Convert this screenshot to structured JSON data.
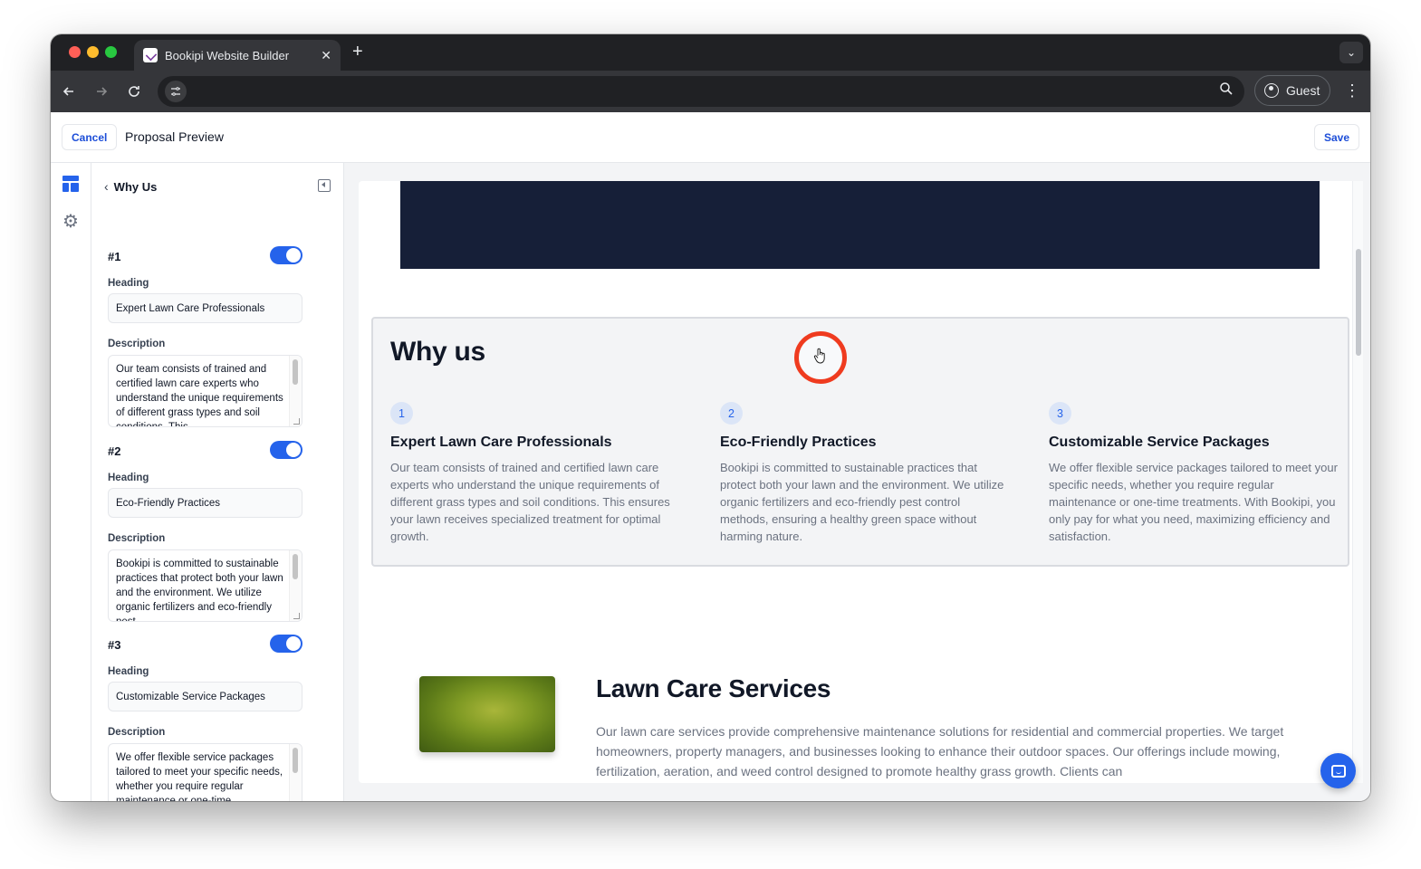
{
  "browser": {
    "tab_title": "Bookipi Website Builder",
    "tab_close": "✕",
    "new_tab": "+",
    "menu_chevron": "⌄",
    "url": "",
    "profile": "Guest",
    "kebab": "⋮",
    "icons": [
      "back-icon",
      "forward-icon",
      "reload-icon",
      "site-info-icon",
      "zoom-icon",
      "profile-icon"
    ]
  },
  "header": {
    "cancel_label": "Cancel",
    "title": "Proposal Preview",
    "save_label": "Save",
    "accent": "#1d4ed8"
  },
  "panel": {
    "back_chevron": "‹",
    "title": "Why Us",
    "heading_label": "Heading",
    "description_label": "Description",
    "items": [
      {
        "num": "#1",
        "enabled": true,
        "heading": "Expert Lawn Care Professionals",
        "description": "Our team consists of trained and certified lawn care experts who understand the unique requirements of different grass types and soil conditions. This"
      },
      {
        "num": "#2",
        "enabled": true,
        "heading": "Eco-Friendly Practices",
        "description": "Bookipi is committed to sustainable practices that protect both your lawn and the environment. We utilize organic fertilizers and eco-friendly pest"
      },
      {
        "num": "#3",
        "enabled": true,
        "heading": "Customizable Service Packages",
        "description": "We offer flexible service packages tailored to meet your specific needs, whether you require regular maintenance or one-time treatments. With Bookipi, you only"
      }
    ]
  },
  "preview": {
    "why_title": "Why us",
    "columns": [
      {
        "num": "1",
        "heading": "Expert Lawn Care Professionals",
        "description": "Our team consists of trained and certified lawn care experts who understand the unique requirements of different grass types and soil conditions. This ensures your lawn receives specialized treatment for optimal growth."
      },
      {
        "num": "2",
        "heading": "Eco-Friendly Practices",
        "description": "Bookipi is committed to sustainable practices that protect both your lawn and the environment. We utilize organic fertilizers and eco-friendly pest control methods, ensuring a healthy green space without harming nature."
      },
      {
        "num": "3",
        "heading": "Customizable Service Packages",
        "description": "We offer flexible service packages tailored to meet your specific needs, whether you require regular maintenance or one-time treatments. With Bookipi, you only pay for what you need, maximizing efficiency and satisfaction."
      }
    ],
    "services_title": "Lawn Care Services",
    "services_description": "Our lawn care services provide comprehensive maintenance solutions for residential and commercial properties. We target homeowners, property managers, and businesses looking to enhance their outdoor spaces. Our offerings include mowing, fertilization, aeration, and weed control designed to promote healthy grass growth. Clients can",
    "banner_color": "#161f38",
    "cursor_ring_color": "#ef3b1f"
  }
}
